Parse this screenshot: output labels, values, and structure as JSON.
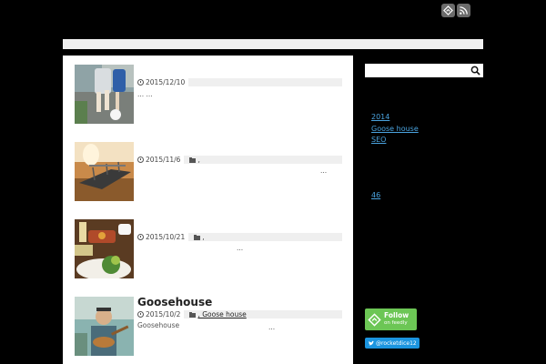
{
  "header": {
    "icons": [
      "feedly-icon",
      "rss-icon"
    ]
  },
  "posts": [
    {
      "title": "",
      "date": "2015/12/10",
      "category": "",
      "excerpt": "... ...",
      "ellipsis": ""
    },
    {
      "title": "",
      "date": "2015/11/6",
      "category": ",",
      "excerpt": "",
      "ellipsis": "..."
    },
    {
      "title": "",
      "date": "2015/10/21",
      "category": ",",
      "excerpt": "",
      "ellipsis": "..."
    },
    {
      "title": "Goosehouse",
      "date": "2015/10/2",
      "category": ", Goose house",
      "excerpt": "Goosehouse",
      "ellipsis": "..."
    }
  ],
  "sidebar": {
    "search": {
      "value": "",
      "placeholder": ""
    },
    "links": [
      "2014",
      "Goose house",
      "SEO"
    ],
    "number_link": "46",
    "feedly": {
      "label": "Follow",
      "sub": "on feedly"
    },
    "twitter": {
      "handle": "@rocketdice12"
    }
  },
  "colors": {
    "background": "#000000",
    "link": "#4aa3df",
    "feedly": "#6cc655",
    "twitter": "#1b95e0"
  }
}
